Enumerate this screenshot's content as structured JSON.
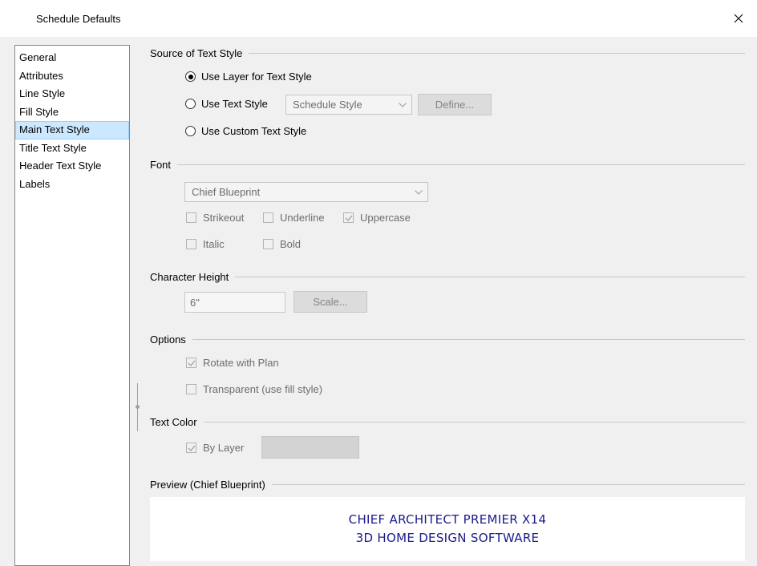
{
  "window": {
    "title": "Schedule Defaults"
  },
  "nav": {
    "items": [
      "General",
      "Attributes",
      "Line Style",
      "Fill Style",
      "Main Text Style",
      "Title Text Style",
      "Header Text Style",
      "Labels"
    ],
    "selected": "Main Text Style"
  },
  "source": {
    "title": "Source of Text Style",
    "use_layer": "Use Layer for Text Style",
    "use_text_style": "Use Text Style",
    "style_select": "Schedule Style",
    "define_button": "Define...",
    "use_custom": "Use Custom Text Style",
    "selected": "use_layer"
  },
  "font": {
    "title": "Font",
    "font_select": "Chief Blueprint",
    "strikeout": {
      "label": "Strikeout",
      "checked": false
    },
    "underline": {
      "label": "Underline",
      "checked": false
    },
    "uppercase": {
      "label": "Uppercase",
      "checked": true
    },
    "italic": {
      "label": "Italic",
      "checked": false
    },
    "bold": {
      "label": "Bold",
      "checked": false
    }
  },
  "char_height": {
    "title": "Character Height",
    "value": "6\"",
    "scale_button": "Scale..."
  },
  "options": {
    "title": "Options",
    "rotate": {
      "label": "Rotate with Plan",
      "checked": true
    },
    "transparent": {
      "label": "Transparent (use fill style)",
      "checked": false
    }
  },
  "text_color": {
    "title": "Text Color",
    "by_layer": {
      "label": "By Layer",
      "checked": true
    },
    "swatch_color": "#d3d3d3"
  },
  "preview": {
    "title": "Preview (Chief Blueprint)",
    "line1": "Chief Architect Premier X14",
    "line2": "3D Home Design Software"
  }
}
